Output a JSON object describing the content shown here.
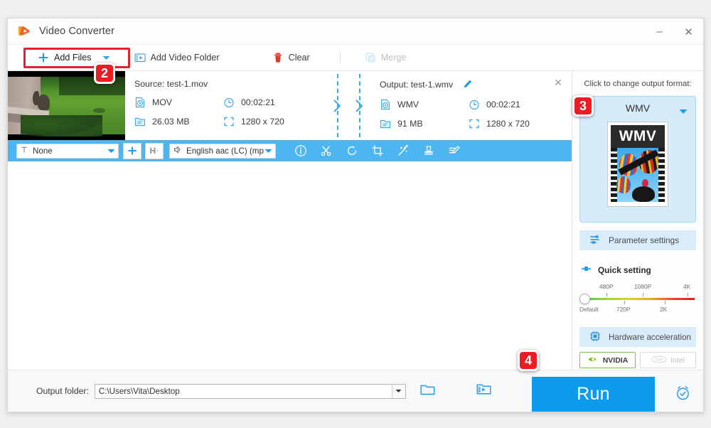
{
  "window": {
    "title": "Video Converter",
    "minimize_label": "–",
    "close_label": "✕"
  },
  "toolbar": {
    "add_files_label": "Add Files",
    "add_video_folder_label": "Add Video Folder",
    "clear_label": "Clear",
    "merge_label": "Merge"
  },
  "steps": {
    "badge2": "2",
    "badge3": "3",
    "badge4": "4"
  },
  "file_item": {
    "source_label": "Source: test-1.mov",
    "source_format": "MOV",
    "source_duration": "00:02:21",
    "source_size": "26.03 MB",
    "source_resolution": "1280 x 720",
    "output_label": "Output: test-1.wmv",
    "output_format": "WMV",
    "output_duration": "00:02:21",
    "output_size": "91 MB",
    "output_resolution": "1280 x 720",
    "close_label": "✕"
  },
  "blue_strip": {
    "subtitle_value": "None",
    "audio_value": "English aac (LC) (mp",
    "hardware_label": "H",
    "plus_label": "+",
    "tools": [
      "info-icon",
      "cut-icon",
      "rotate-icon",
      "crop-icon",
      "effect-icon",
      "watermark-icon",
      "subtitle-edit-icon"
    ]
  },
  "right_panel": {
    "hint": "Click to change output format:",
    "format_name": "WMV",
    "format_thumb_label": "WMV",
    "parameter_settings_label": "Parameter settings",
    "quick_setting_label": "Quick setting",
    "slider": {
      "top_labels": [
        "480P",
        "1080P",
        "4K"
      ],
      "bottom_labels": [
        "Default",
        "720P",
        "2K"
      ],
      "value": "Default"
    },
    "hardware_acceleration_label": "Hardware acceleration",
    "vendors": [
      {
        "name": "NVIDIA",
        "enabled": true
      },
      {
        "name": "Intel",
        "enabled": false
      }
    ]
  },
  "bottom": {
    "output_folder_label": "Output folder:",
    "output_folder_path": "C:\\Users\\Vita\\Desktop",
    "run_label": "Run"
  },
  "colors": {
    "accent_blue": "#0c9aeb",
    "strip_blue": "#4db6f0",
    "badge_red": "#ec1c24",
    "panel_blue": "#d6ecfb"
  }
}
